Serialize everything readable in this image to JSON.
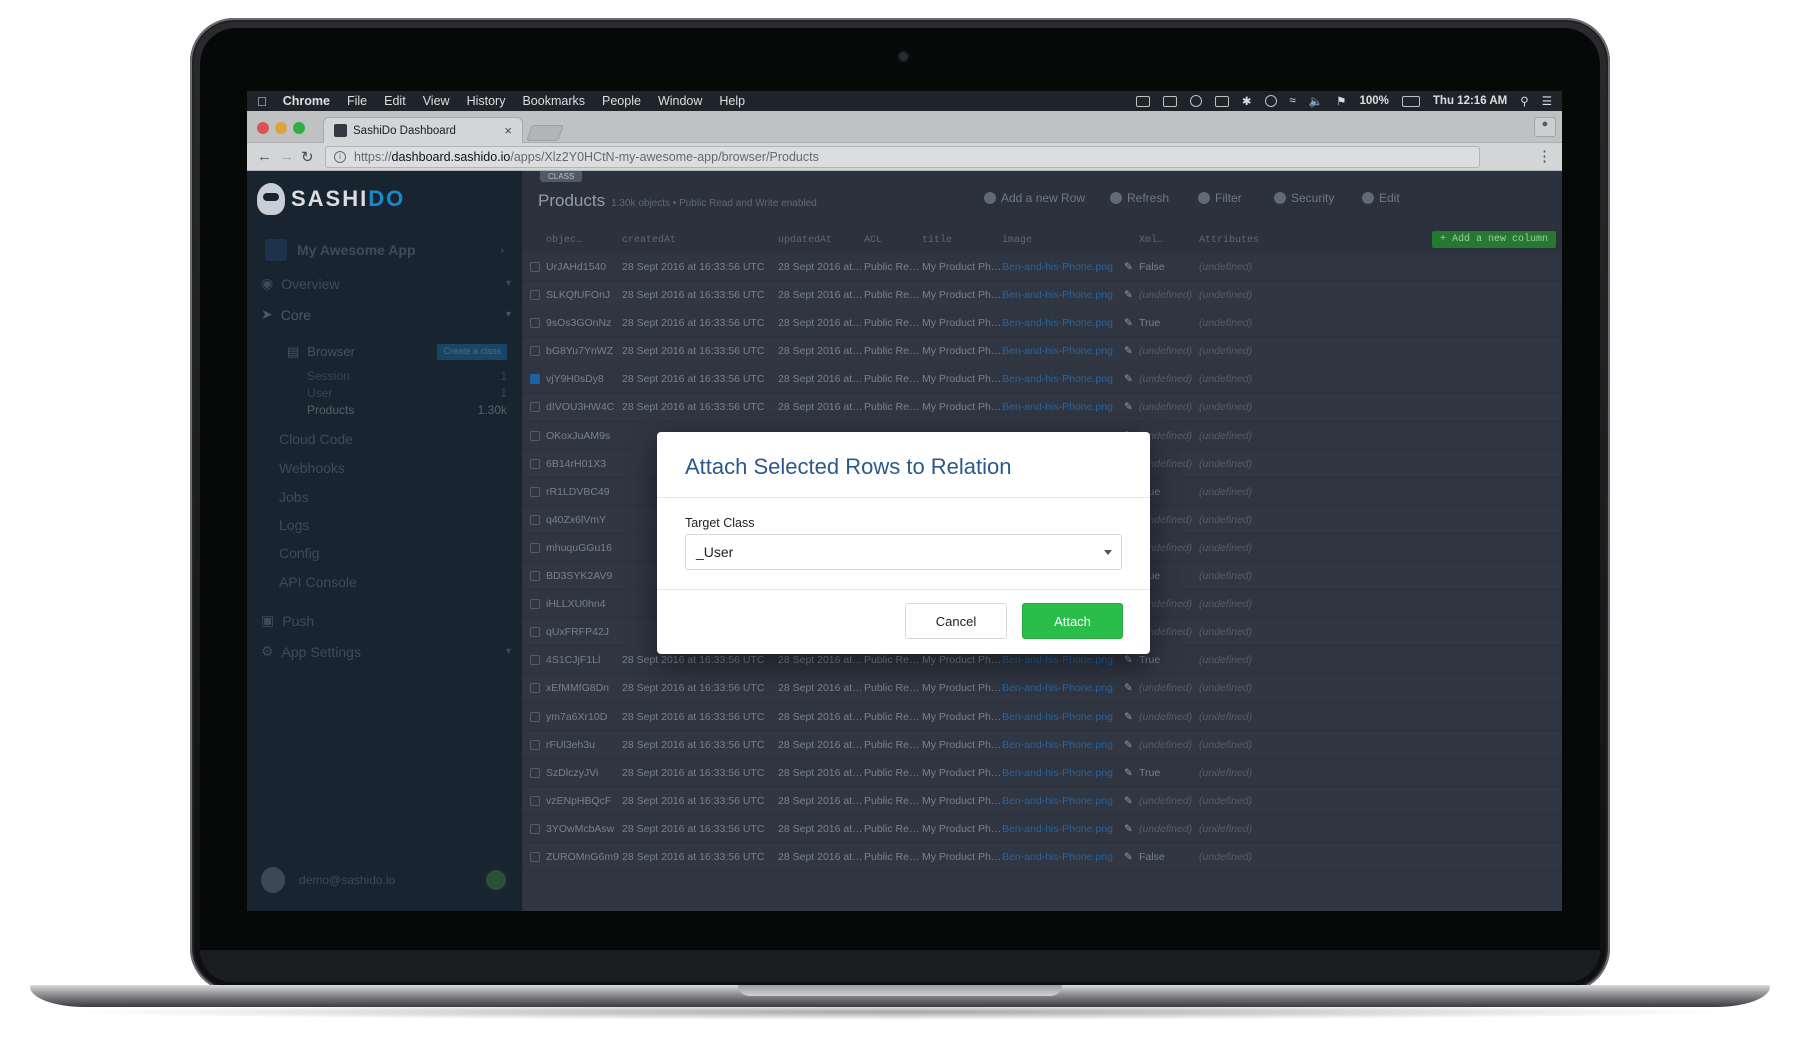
{
  "menubar": {
    "items": [
      "Chrome",
      "File",
      "Edit",
      "View",
      "History",
      "Bookmarks",
      "People",
      "Window",
      "Help"
    ],
    "battery": "100%",
    "clock": "Thu 12:16 AM"
  },
  "browser": {
    "tab_title": "SashiDo Dashboard",
    "url_scheme": "https://",
    "url_host": "dashboard.sashido.io",
    "url_path": "/apps/Xlz2Y0HCtN-my-awesome-app/browser/Products"
  },
  "sidebar": {
    "logo_a": "SASHI",
    "logo_b": "DO",
    "app_name": "My Awesome App",
    "items": {
      "overview": "Overview",
      "core": "Core",
      "browser": "Browser",
      "create_class": "Create a class",
      "session": "Session",
      "user": "User",
      "products": "Products",
      "products_count": "1.30k",
      "cloud_code": "Cloud Code",
      "webhooks": "Webhooks",
      "jobs": "Jobs",
      "logs": "Logs",
      "config": "Config",
      "api_console": "API Console",
      "push": "Push",
      "app_settings": "App Settings"
    },
    "user_email": "demo@sashido.io"
  },
  "toolbar": {
    "class_tag": "CLASS",
    "title": "Products",
    "subtitle": "1.30k objects • Public Read and Write enabled",
    "add_row": "Add a new Row",
    "refresh": "Refresh",
    "filter": "Filter",
    "security": "Security",
    "edit": "Edit"
  },
  "table": {
    "headers": [
      "objec…",
      "createdAt",
      "updatedAt",
      "ACL",
      "title",
      "image",
      "Xml…",
      "Attributes"
    ],
    "add_column": "+ Add a new column",
    "rows": [
      {
        "id": "UrJAHd1540",
        "c": "28 Sept 2016 at 16:33:56 UTC",
        "u": "28 Sept 2016 at…",
        "acl": "Public Re…",
        "t": "My Product Ph…",
        "img": "Ben-and-his-Phone.png",
        "x": "False",
        "a": "(undefined)"
      },
      {
        "id": "SLKQfUFOnJ",
        "c": "28 Sept 2016 at 16:33:56 UTC",
        "u": "28 Sept 2016 at…",
        "acl": "Public Re…",
        "t": "My Product Ph…",
        "img": "Ben-and-his-Phone.png",
        "x": "(undefined)",
        "a": "(undefined)"
      },
      {
        "id": "9sOs3GOnNz",
        "c": "28 Sept 2016 at 16:33:56 UTC",
        "u": "28 Sept 2016 at…",
        "acl": "Public Re…",
        "t": "My Product Ph…",
        "img": "Ben-and-his-Phone.png",
        "x": "True",
        "a": "(undefined)"
      },
      {
        "id": "bG8Yu7YnWZ",
        "c": "28 Sept 2016 at 16:33:56 UTC",
        "u": "28 Sept 2016 at…",
        "acl": "Public Re…",
        "t": "My Product Ph…",
        "img": "Ben-and-his-Phone.png",
        "x": "(undefined)",
        "a": "(undefined)"
      },
      {
        "id": "vjY9H0sDy8",
        "c": "28 Sept 2016 at 16:33:56 UTC",
        "u": "28 Sept 2016 at…",
        "acl": "Public Re…",
        "t": "My Product Ph…",
        "img": "Ben-and-his-Phone.png",
        "x": "(undefined)",
        "a": "(undefined)",
        "checked": true
      },
      {
        "id": "dIVOU3HW4C",
        "c": "28 Sept 2016 at 16:33:56 UTC",
        "u": "28 Sept 2016 at…",
        "acl": "Public Re…",
        "t": "My Product Ph…",
        "img": "Ben-and-his-Phone.png",
        "x": "(undefined)",
        "a": "(undefined)"
      },
      {
        "id": "OKoxJuAM9s",
        "c": "",
        "u": "",
        "acl": "",
        "t": "",
        "img": "ne.png",
        "x": "(undefined)",
        "a": "(undefined)"
      },
      {
        "id": "6B14rH01X3",
        "c": "",
        "u": "",
        "acl": "",
        "t": "",
        "img": "ne.png",
        "x": "(undefined)",
        "a": "(undefined)"
      },
      {
        "id": "rR1LDVBC49",
        "c": "",
        "u": "",
        "acl": "",
        "t": "",
        "img": "ne.png",
        "x": "True",
        "a": "(undefined)"
      },
      {
        "id": "q40Zx6lVmY",
        "c": "",
        "u": "",
        "acl": "",
        "t": "",
        "img": "ne.png",
        "x": "(undefined)",
        "a": "(undefined)"
      },
      {
        "id": "mhuquGGu16",
        "c": "",
        "u": "",
        "acl": "",
        "t": "",
        "img": "ne.png",
        "x": "(undefined)",
        "a": "(undefined)"
      },
      {
        "id": "BD3SYK2AV9",
        "c": "",
        "u": "",
        "acl": "",
        "t": "",
        "img": "ne.png",
        "x": "True",
        "a": "(undefined)"
      },
      {
        "id": "iHLLXU0hn4",
        "c": "",
        "u": "",
        "acl": "",
        "t": "",
        "img": "ne.png",
        "x": "(undefined)",
        "a": "(undefined)"
      },
      {
        "id": "qUxFRFP42J",
        "c": "",
        "u": "",
        "acl": "",
        "t": "",
        "img": "ne.png",
        "x": "(undefined)",
        "a": "(undefined)"
      },
      {
        "id": "4S1CJjF1Ll",
        "c": "28 Sept 2016 at 16:33:56 UTC",
        "u": "28 Sept 2016 at…",
        "acl": "Public Re…",
        "t": "My Product Ph…",
        "img": "Ben-and-his-Phone.png",
        "x": "True",
        "a": "(undefined)"
      },
      {
        "id": "xEfMMfG8Dn",
        "c": "28 Sept 2016 at 16:33:56 UTC",
        "u": "28 Sept 2016 at…",
        "acl": "Public Re…",
        "t": "My Product Ph…",
        "img": "Ben-and-his-Phone.png",
        "x": "(undefined)",
        "a": "(undefined)"
      },
      {
        "id": "ym7a6Xr10D",
        "c": "28 Sept 2016 at 16:33:56 UTC",
        "u": "28 Sept 2016 at…",
        "acl": "Public Re…",
        "t": "My Product Ph…",
        "img": "Ben-and-his-Phone.png",
        "x": "(undefined)",
        "a": "(undefined)"
      },
      {
        "id": "rFUl3eh3u",
        "c": "28 Sept 2016 at 16:33:56 UTC",
        "u": "28 Sept 2016 at…",
        "acl": "Public Re…",
        "t": "My Product Ph…",
        "img": "Ben-and-his-Phone.png",
        "x": "(undefined)",
        "a": "(undefined)"
      },
      {
        "id": "SzDlczyJVi",
        "c": "28 Sept 2016 at 16:33:56 UTC",
        "u": "28 Sept 2016 at…",
        "acl": "Public Re…",
        "t": "My Product Ph…",
        "img": "Ben-and-his-Phone.png",
        "x": "True",
        "a": "(undefined)"
      },
      {
        "id": "vzENpHBQcF",
        "c": "28 Sept 2016 at 16:33:56 UTC",
        "u": "28 Sept 2016 at…",
        "acl": "Public Re…",
        "t": "My Product Ph…",
        "img": "Ben-and-his-Phone.png",
        "x": "(undefined)",
        "a": "(undefined)"
      },
      {
        "id": "3YOwMcbAsw",
        "c": "28 Sept 2016 at 16:33:56 UTC",
        "u": "28 Sept 2016 at…",
        "acl": "Public Re…",
        "t": "My Product Ph…",
        "img": "Ben-and-his-Phone.png",
        "x": "(undefined)",
        "a": "(undefined)"
      },
      {
        "id": "ZUROMnG6m9",
        "c": "28 Sept 2016 at 16:33:56 UTC",
        "u": "28 Sept 2016 at…",
        "acl": "Public Re…",
        "t": "My Product Ph…",
        "img": "Ben-and-his-Phone.png",
        "x": "False",
        "a": "(undefined)"
      }
    ]
  },
  "modal": {
    "title": "Attach Selected Rows to Relation",
    "field_label": "Target Class",
    "selected_value": "_User",
    "cancel_label": "Cancel",
    "attach_label": "Attach"
  },
  "colors": {
    "accent_green": "#2abd4a",
    "title_blue": "#2b5a8a",
    "sidebar_bg": "#1b2634"
  }
}
